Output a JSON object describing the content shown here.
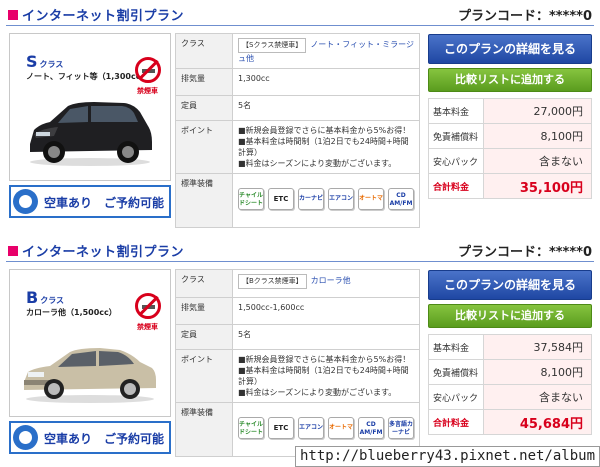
{
  "plans": [
    {
      "title": "インターネット割引プラン",
      "code": "プランコード：*****0",
      "class_letter": "S",
      "class_suffix": "クラス",
      "class_sub": "ノート、フィット等（1,300cc）",
      "no_smoking": "禁煙車",
      "availability": "空車あり　ご予約可能",
      "spec": {
        "class_label": "クラス",
        "class_box": "【Sクラス禁煙車】",
        "class_models": "ノート・フィット・ミラージュ他",
        "displacement_label": "排気量",
        "displacement": "1,300cc",
        "capacity_label": "定員",
        "capacity": "5名",
        "points_label": "ポイント",
        "points_1": "■新規会員登録でさらに基本料金から5%お得！",
        "points_2": "■基本料金は時間制（1泊2日でも24時間+時間計算）",
        "points_3": "■料金はシーズンにより変動がございます。",
        "equipment_label": "標準装備",
        "equipment": [
          "チャイルドシート",
          "ETC",
          "カーナビ",
          "エアコン",
          "オートマ",
          "CD AM/FM"
        ]
      },
      "detail_button": "このプランの詳細を見る",
      "compare_button": "比較リストに追加する",
      "prices": {
        "base_label": "基本料金",
        "base": "27,000円",
        "insurance_label": "免責補償料",
        "insurance": "8,100円",
        "pack_label": "安心パック",
        "pack": "含まない",
        "total_label": "合計料金",
        "total": "35,100円"
      }
    },
    {
      "title": "インターネット割引プラン",
      "code": "プランコード：*****0",
      "class_letter": "B",
      "class_suffix": "クラス",
      "class_sub": "カローラ他（1,500cc）",
      "no_smoking": "禁煙車",
      "availability": "空車あり　ご予約可能",
      "spec": {
        "class_label": "クラス",
        "class_box": "【Bクラス禁煙車】",
        "class_models": "カローラ他",
        "displacement_label": "排気量",
        "displacement": "1,500cc-1,600cc",
        "capacity_label": "定員",
        "capacity": "5名",
        "points_label": "ポイント",
        "points_1": "■新規会員登録でさらに基本料金から5%お得！",
        "points_2": "■基本料金は時間制（1泊2日でも24時間+時間計算）",
        "points_3": "■料金はシーズンにより変動がございます。",
        "equipment_label": "標準装備",
        "equipment": [
          "チャイルドシート",
          "ETC",
          "エアコン",
          "オートマ",
          "CD AM/FM",
          "多言語カーナビ"
        ]
      },
      "detail_button": "このプランの詳細を見る",
      "compare_button": "比較リストに追加する",
      "prices": {
        "base_label": "基本料金",
        "base": "37,584円",
        "insurance_label": "免責補償料",
        "insurance": "8,100円",
        "pack_label": "安心パック",
        "pack": "含まない",
        "total_label": "合計料金",
        "total": "45,684円"
      }
    }
  ],
  "watermark": "http://blueberry43.pixnet.net/album"
}
